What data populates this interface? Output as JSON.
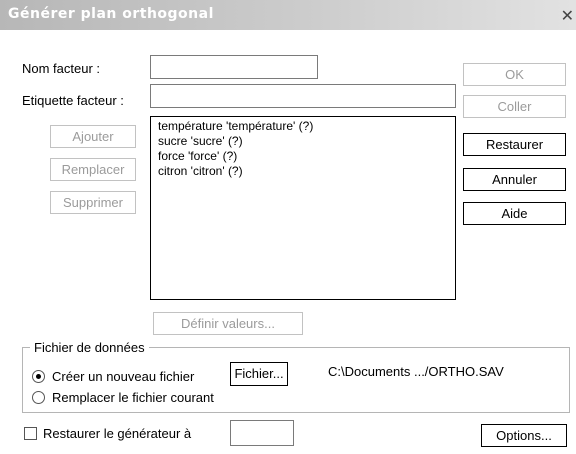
{
  "window": {
    "title": "Générer plan orthogonal"
  },
  "labels": {
    "nom_facteur": "Nom facteur :",
    "etiquette_facteur": "Etiquette facteur :"
  },
  "fields": {
    "nom_facteur": "",
    "etiquette_facteur": "",
    "generator_seed": ""
  },
  "buttons": {
    "ok": "OK",
    "coller": "Coller",
    "restaurer": "Restaurer",
    "annuler": "Annuler",
    "aide": "Aide",
    "ajouter": "Ajouter",
    "remplacer": "Remplacer",
    "supprimer": "Supprimer",
    "definir_valeurs": "Définir valeurs...",
    "fichier": "Fichier...",
    "options": "Options..."
  },
  "factors": [
    "température 'température' (?)",
    "sucre 'sucre' (?)",
    "force 'force' (?)",
    "citron 'citron' (?)"
  ],
  "data_file": {
    "group_label": "Fichier de données",
    "option_new": "Créer un nouveau fichier",
    "option_replace": "Remplacer le fichier courant",
    "path": "C:\\Documents .../ORTHO.SAV"
  },
  "restore_generator": {
    "label": "Restaurer le générateur à"
  }
}
